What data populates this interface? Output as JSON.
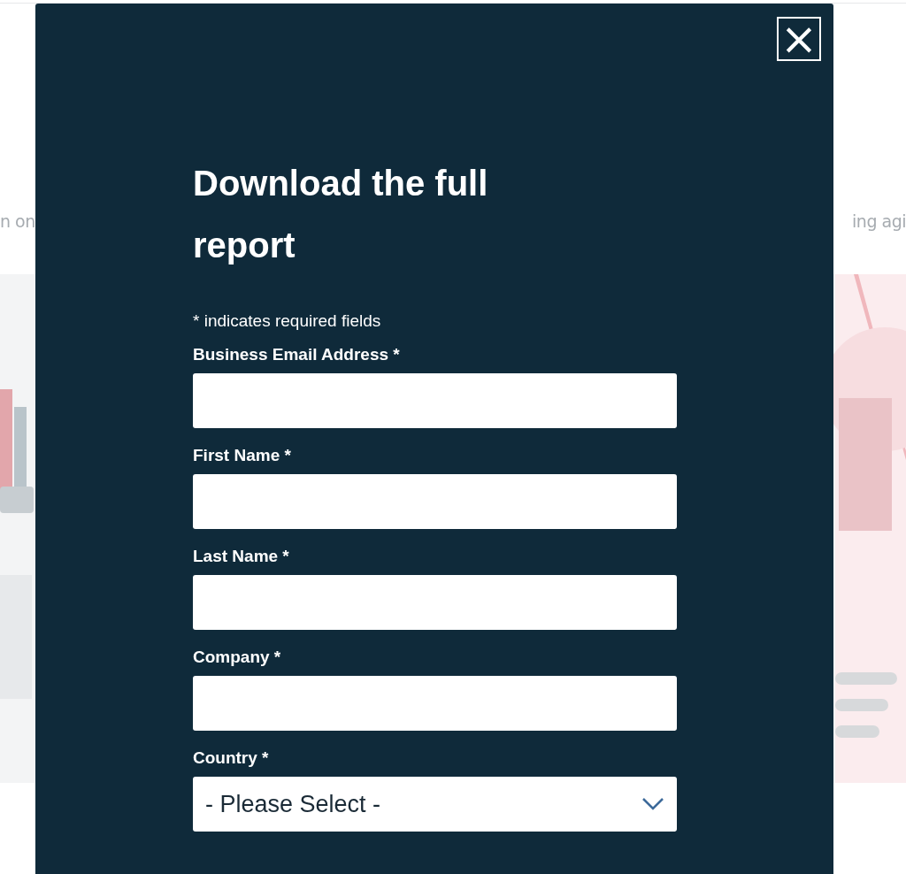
{
  "background_page": {
    "subtitle_left": "n on",
    "subtitle_right": "ing agi"
  },
  "modal": {
    "close_icon": "×",
    "title": "Download the full report",
    "required_note": "* indicates required fields",
    "fields": [
      {
        "kind": "text",
        "label": "Business Email Address *"
      },
      {
        "kind": "text",
        "label": "First Name *"
      },
      {
        "kind": "text",
        "label": "Last Name *"
      },
      {
        "kind": "text",
        "label": "Company *"
      },
      {
        "kind": "select",
        "label": "Country *",
        "value": "- Please Select -"
      }
    ]
  }
}
